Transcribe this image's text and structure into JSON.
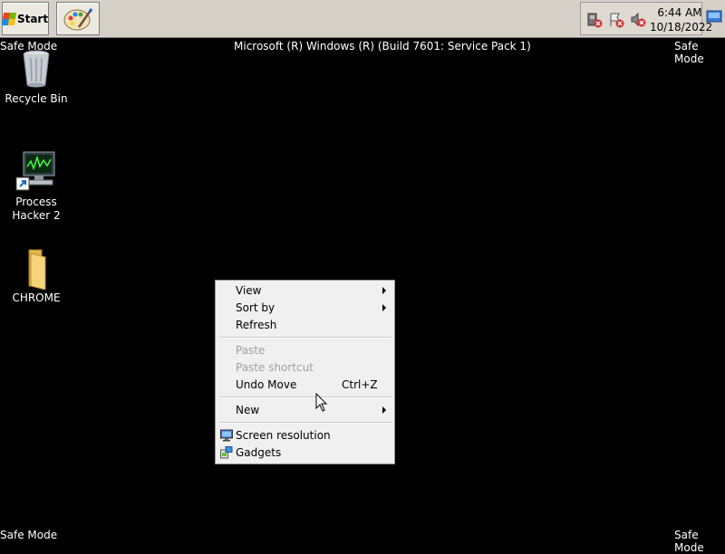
{
  "taskbar": {
    "start_label": "Start",
    "pinned": [
      {
        "icon": "paint-icon"
      }
    ],
    "tray": {
      "icons": [
        "network-error-icon",
        "action-center-error-icon",
        "volume-muted-icon"
      ],
      "time": "6:44 AM",
      "date": "10/18/2022"
    }
  },
  "desktop": {
    "safe_mode_label": "Safe Mode",
    "build_text": "Microsoft (R) Windows (R) (Build 7601: Service Pack 1)",
    "icons": [
      {
        "label_line1": "Recycle Bin",
        "label_line2": "",
        "icon": "recycle-bin-icon"
      },
      {
        "label_line1": "Process",
        "label_line2": "Hacker 2",
        "icon": "process-hacker-icon"
      },
      {
        "label_line1": "CHROME",
        "label_line2": "",
        "icon": "folder-icon"
      }
    ]
  },
  "context_menu": {
    "view": "View",
    "sort_by": "Sort by",
    "refresh": "Refresh",
    "paste": "Paste",
    "paste_shortcut": "Paste shortcut",
    "undo_move": "Undo Move",
    "undo_move_shortcut": "Ctrl+Z",
    "new": "New",
    "screen_resolution": "Screen resolution",
    "gadgets": "Gadgets"
  }
}
